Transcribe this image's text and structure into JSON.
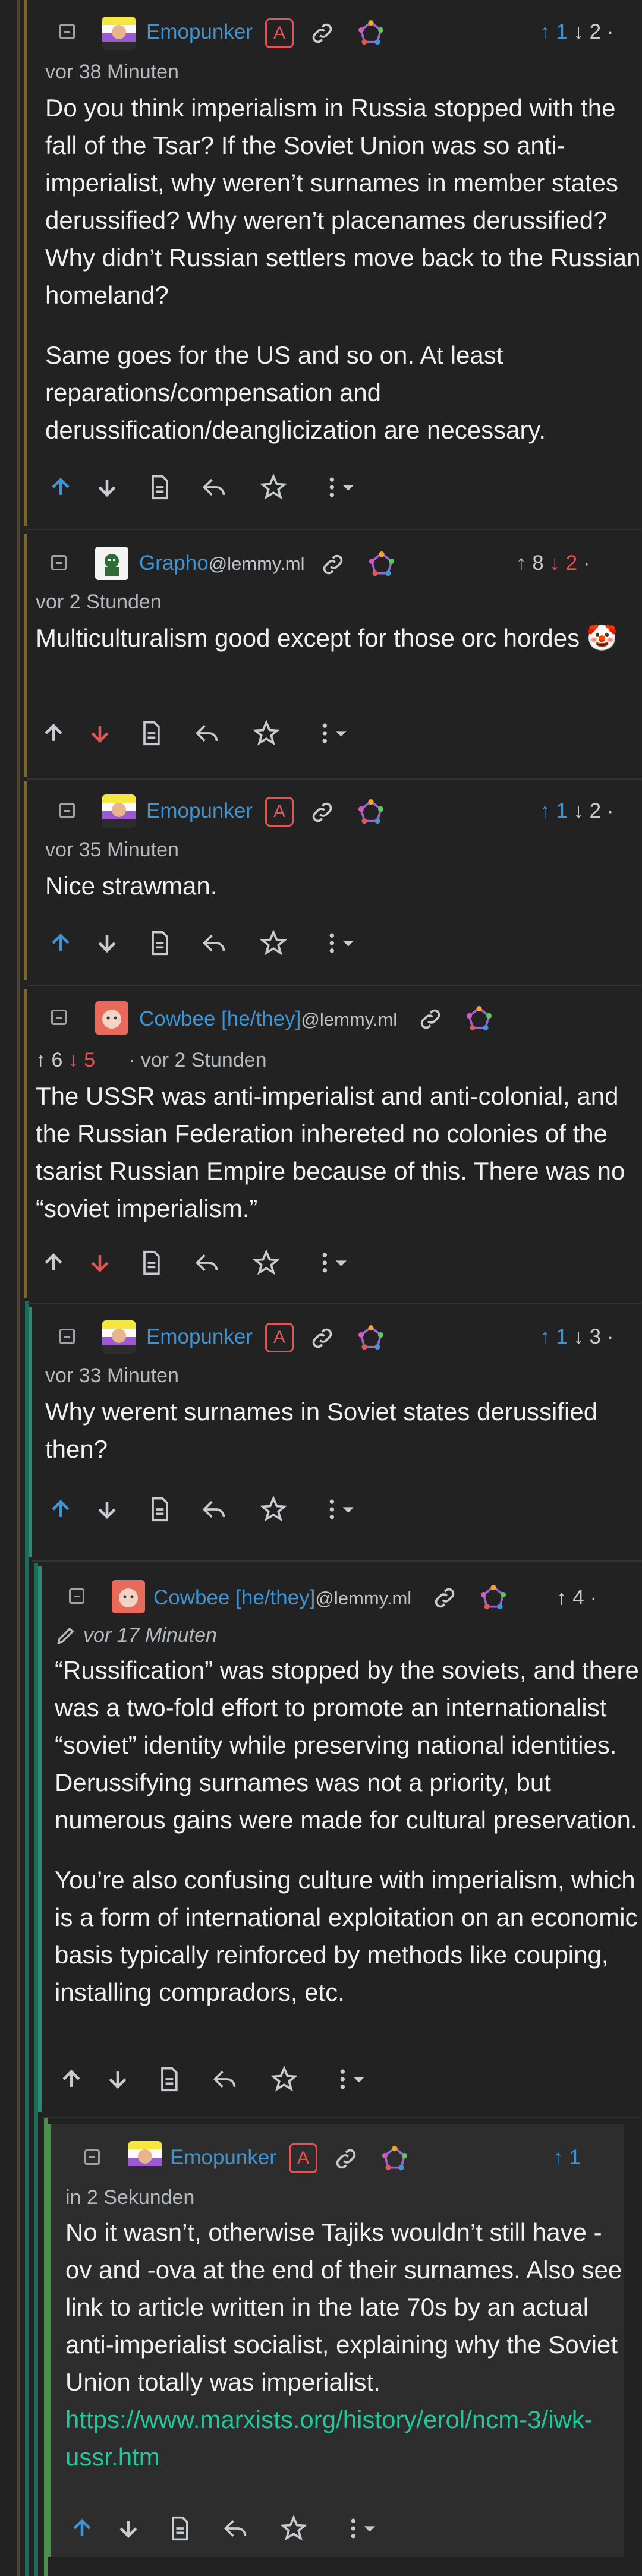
{
  "icons": {
    "collapse": "collapse-minus-icon",
    "link": "link-icon",
    "fediverse": "fediverse-icon",
    "upvote": "arrow-up-icon",
    "downvote": "arrow-down-icon",
    "source": "view-source-icon",
    "reply": "reply-icon",
    "save": "star-icon",
    "more": "more-options-icon",
    "edited": "pencil-icon"
  },
  "colors": {
    "background": "#222222",
    "username": "#3f95d4",
    "upvote": "#3f95d4",
    "downvote": "#e55353",
    "link": "#22c79a",
    "admin_badge": "#e55353"
  },
  "comments": [
    {
      "author": "Emopunker",
      "instance": "",
      "admin_badge": "A",
      "votes_up": "1",
      "votes_down": "2",
      "time": "vor 38 Minuten",
      "paragraphs": [
        "Do you think imperialism in Russia stopped with the fall of the Tsar? If the Soviet Union was so anti-imperialist, why weren’t surnames in member states derussified? Why weren’t placenames derussified? Why didn’t Russian settlers move back to the Russian homeland?",
        "Same goes for the US and so on. At least reparations/compensation and derussification/deanglicization are necessary."
      ]
    },
    {
      "author": "Grapho",
      "instance": "@lemmy.ml",
      "votes_up": "8",
      "votes_down": "2",
      "time": "vor 2 Stunden",
      "paragraphs": [
        "Multiculturalism good except for those orc hordes 🤡"
      ]
    },
    {
      "author": "Emopunker",
      "instance": "",
      "admin_badge": "A",
      "votes_up": "1",
      "votes_down": "2",
      "time": "vor 35 Minuten",
      "paragraphs": [
        "Nice strawman."
      ]
    },
    {
      "author": "Cowbee [he/they]",
      "instance": "@lemmy.ml",
      "votes_up": "6",
      "votes_down": "5",
      "time": "vor 2 Stunden",
      "paragraphs": [
        "The USSR was anti-imperialist and anti-colonial, and the Russian Federation inhereted no colonies of the tsarist Russian Empire because of this. There was no “soviet imperialism.”"
      ]
    },
    {
      "author": "Emopunker",
      "instance": "",
      "admin_badge": "A",
      "votes_up": "1",
      "votes_down": "3",
      "time": "vor 33 Minuten",
      "paragraphs": [
        "Why werent surnames in Soviet states derussified then?"
      ]
    },
    {
      "author": "Cowbee [he/they]",
      "instance": "@lemmy.ml",
      "votes_up": "4",
      "time": "vor 17 Minuten",
      "paragraphs": [
        "“Russification” was stopped by the soviets, and there was a two-fold effort to promote an internationalist “soviet” identity while preserving national identities. Derussifying surnames was not a priority, but numerous gains were made for cultural preservation.",
        "You’re also confusing culture with imperialism, which is a form of international exploitation on an economic basis typically reinforced by methods like couping, installing compradors, etc."
      ]
    },
    {
      "author": "Emopunker",
      "instance": "",
      "admin_badge": "A",
      "votes_up": "1",
      "time": "in 2 Sekunden",
      "paragraphs": [
        "No it wasn’t, otherwise Tajiks wouldn’t still have -ov and -ova at the end of their surnames. Also see link to article written in the late 70s by an actual anti-imperialist socialist, explaining why the Soviet Union totally was imperialist."
      ],
      "link": "https://www.marxists.org/history/erol/ncm-3/iwk-ussr.htm"
    }
  ]
}
